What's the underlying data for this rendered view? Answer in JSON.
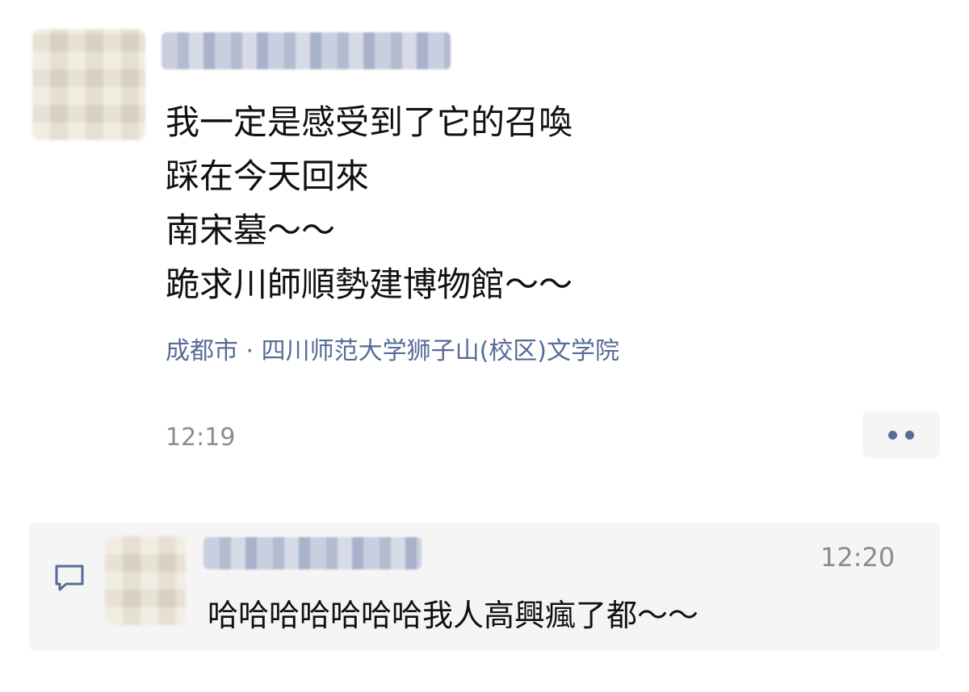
{
  "post": {
    "lines": [
      "我一定是感受到了它的召喚",
      "踩在今天回來",
      "南宋墓～～",
      "跪求川師順勢建博物館～～"
    ],
    "location": "成都市 · 四川师范大学狮子山(校区)文学院",
    "time": "12:19"
  },
  "comment": {
    "time": "12:20",
    "text": "哈哈哈哈哈哈哈我人高興瘋了都～～"
  },
  "icons": {
    "more": "more-dots-icon",
    "comment": "comment-icon"
  },
  "colors": {
    "link": "#576b95",
    "timestamp": "#8c8c8c",
    "panel_bg": "#f5f5f5"
  }
}
